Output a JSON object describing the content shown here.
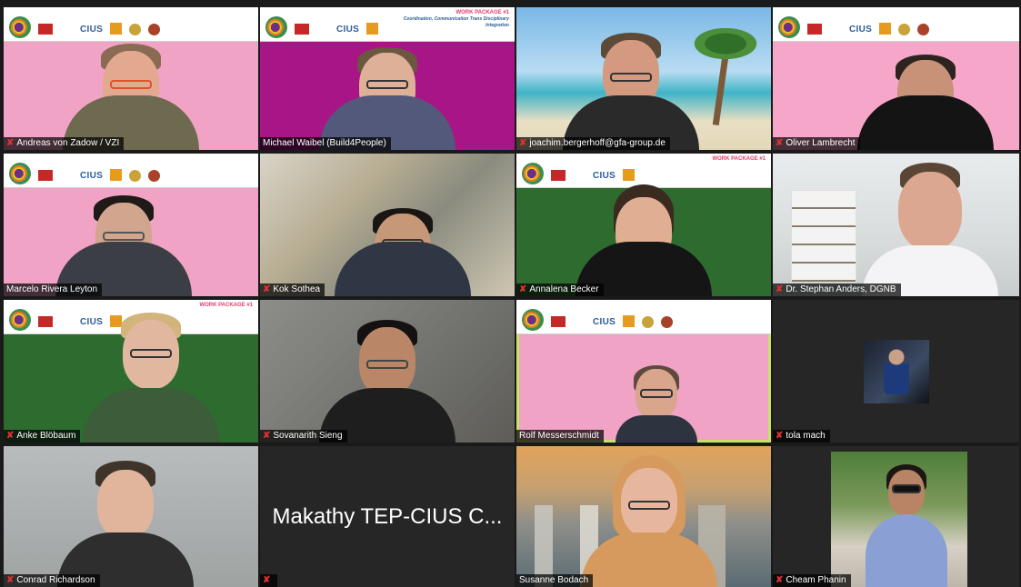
{
  "banner": {
    "consortium": "CIUS",
    "work_package": "WORK PACKAGE #1",
    "work_package_sub": "Coordination, Communication Trans Disciplinary Integration"
  },
  "participants": [
    {
      "name": "Andreas von Zadow / VZI",
      "muted": true
    },
    {
      "name": "Michael Waibel (Build4People)",
      "muted": false
    },
    {
      "name": "joachim.bergerhoff@gfa-group.de",
      "muted": true
    },
    {
      "name": "Oliver Lambrecht",
      "muted": true
    },
    {
      "name": "Marcelo Rivera Leyton",
      "muted": false
    },
    {
      "name": "Kok Sothea",
      "muted": true
    },
    {
      "name": "Annalena Becker",
      "muted": true
    },
    {
      "name": "Dr. Stephan Anders, DGNB",
      "muted": true
    },
    {
      "name": "Anke Blöbaum",
      "muted": true
    },
    {
      "name": "Sovanarith Sieng",
      "muted": true
    },
    {
      "name": "Rolf Messerschmidt",
      "muted": false
    },
    {
      "name": "tola mach",
      "muted": true
    },
    {
      "name": "Conrad Richardson",
      "muted": true
    },
    {
      "name": "",
      "display_name": "Makathy TEP-CIUS C...",
      "muted": true
    },
    {
      "name": "Susanne Bodach",
      "muted": false
    },
    {
      "name": "Cheam Phanin",
      "muted": true
    }
  ],
  "mic_off_glyph": "✘",
  "colors": {
    "active_speaker_border": "#c7e26a",
    "mic_off": "#e03131"
  }
}
